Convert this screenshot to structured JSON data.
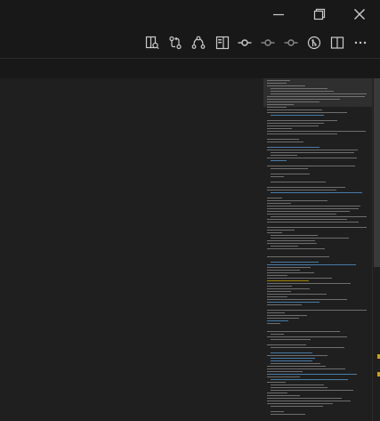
{
  "window": {
    "controls": [
      {
        "name": "minimize-icon",
        "glyph": "minimize"
      },
      {
        "name": "restore-icon",
        "glyph": "restore"
      },
      {
        "name": "close-icon",
        "glyph": "close"
      }
    ]
  },
  "toolbar": {
    "actions": [
      {
        "name": "open-preview-to-side-icon"
      },
      {
        "name": "compare-changes-icon"
      },
      {
        "name": "git-graph-icon"
      },
      {
        "name": "toggle-blame-icon"
      },
      {
        "name": "timeline-icon"
      },
      {
        "name": "previous-change-icon"
      },
      {
        "name": "next-change-icon"
      },
      {
        "name": "gitlens-inspect-icon"
      },
      {
        "name": "split-editor-icon"
      },
      {
        "name": "more-actions-icon"
      }
    ]
  },
  "colors": {
    "background": "#1f1f1f",
    "chrome": "#181818",
    "icon": "#cccccc",
    "minimap_text": "#8a8a8a",
    "minimap_heading": "#569cd6",
    "minimap_highlight": "#c8a600",
    "scroll_marker": "#c8a600"
  }
}
